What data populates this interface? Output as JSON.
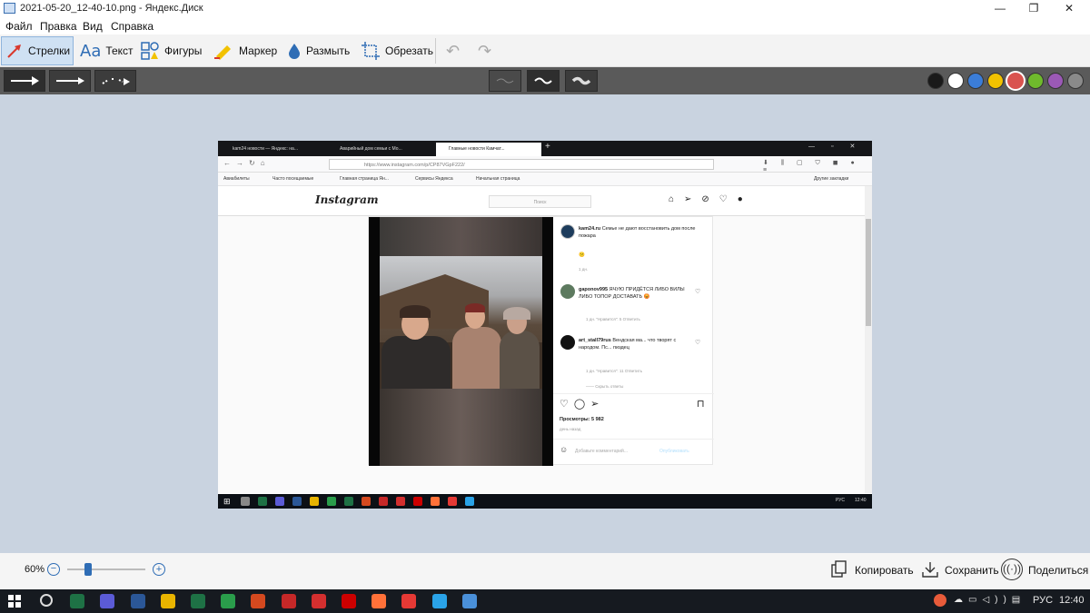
{
  "window": {
    "title": "2021-05-20_12-40-10.png - Яндекс.Диск",
    "minimize": "—",
    "restore": "❐",
    "close": "✕"
  },
  "menu": [
    "Файл",
    "Правка",
    "Вид",
    "Справка"
  ],
  "toolbar": {
    "arrows": "Стрелки",
    "text": "Текст",
    "shapes": "Фигуры",
    "marker": "Маркер",
    "blur": "Размыть",
    "crop": "Обрезать"
  },
  "palette": [
    "#1a1a1a",
    "#ffffff",
    "#3b7dd8",
    "#f2c200",
    "#d9534f",
    "#6fba2c",
    "#9b59b6",
    "#8a8a8a"
  ],
  "selected_color": "#d9534f",
  "screenshot": {
    "tabs": [
      "kam24 новости — Яндекс: на...",
      "Аварийный дом семьи с Мо...",
      "Главные новости Камчат..."
    ],
    "url": "https://www.instagram.com/p/CP87VGpF222/",
    "bookmarks": [
      "Авиабилеты",
      "Часто посещаемые",
      "Главная страница Ян...",
      "Сервисы Яндекса",
      "Начальная страница"
    ],
    "bookmarks_other": "Другие закладки",
    "ig_logo": "Instagram",
    "search_placeholder": "Поиск",
    "post_author": "kam24.ru",
    "post_caption": "Семье не дают восстановить дом после пожара",
    "post_emoji": "😕",
    "post_age": "1 дн.",
    "comments": [
      {
        "user": "gaponov995",
        "text": "ЯЧУЮ ПРИДЁТСЯ ЛИБО ВИЛЫ ЛИБО ТОПОР ДОСТАВАТЬ 😡",
        "meta": "1 дн.   \"Нравится\": 5   Ответить"
      },
      {
        "user": "art_stall79rus",
        "text": "Вендская ма... что творят с народом. Пс... пиздец",
        "meta": "1 дн.   \"Нравится\": 11   Ответить"
      }
    ],
    "hidden_replies": "Скрыть ответы",
    "views": "Просмотры: 5 982",
    "post_time": "день назад",
    "comment_placeholder": "Добавьте комментарий...",
    "publish": "Опубликовать",
    "tray_lang": "РУС",
    "tray_time": "12:40"
  },
  "status": {
    "zoom": "60%",
    "zoom_level": 0.27,
    "copy": "Копировать",
    "save": "Сохранить",
    "share": "Поделиться"
  },
  "taskbar": {
    "lang": "РУС",
    "time": "12:40"
  }
}
